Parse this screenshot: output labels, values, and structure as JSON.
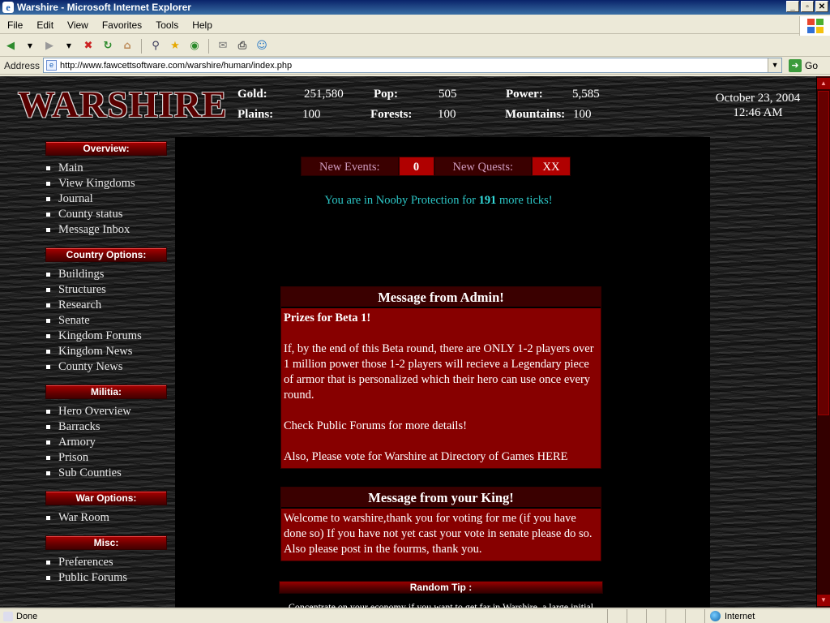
{
  "window": {
    "title": "Warshire - Microsoft Internet Explorer"
  },
  "menu": [
    "File",
    "Edit",
    "View",
    "Favorites",
    "Tools",
    "Help"
  ],
  "address": {
    "label": "Address",
    "url": "http://www.fawcettsoftware.com/warshire/human/index.php",
    "go": "Go"
  },
  "status": {
    "text": "Done",
    "zone": "Internet"
  },
  "page": {
    "logo": "WARSHIRE",
    "stats": {
      "gold_label": "Gold:",
      "gold": "251,580",
      "pop_label": "Pop:",
      "pop": "505",
      "power_label": "Power:",
      "power": "5,585",
      "plains_label": "Plains:",
      "plains": "100",
      "forests_label": "Forests:",
      "forests": "100",
      "mountains_label": "Mountains:",
      "mountains": "100"
    },
    "date": "October 23, 2004",
    "time": "12:46 AM",
    "sidebar": [
      {
        "header": "Overview:",
        "items": [
          "Main",
          "View Kingdoms",
          "Journal",
          "County status",
          "Message Inbox"
        ]
      },
      {
        "header": "Country Options:",
        "items": [
          "Buildings",
          "Structures",
          "Research",
          "Senate",
          "Kingdom Forums",
          "Kingdom News",
          "County News"
        ]
      },
      {
        "header": "Militia:",
        "items": [
          "Hero Overview",
          "Barracks",
          "Armory",
          "Prison",
          "Sub Counties"
        ]
      },
      {
        "header": "War Options:",
        "items": [
          "War Room"
        ]
      },
      {
        "header": "Misc:",
        "items": [
          "Preferences",
          "Public Forums"
        ]
      }
    ],
    "events": {
      "new_events_label": "New Events:",
      "new_events": "0",
      "new_quests_label": "New Quests:",
      "new_quests": "XX"
    },
    "nooby": {
      "prefix": "You are in Nooby Protection for ",
      "ticks": "191",
      "suffix": " more ticks!"
    },
    "admin_msg": {
      "title": "Message from Admin!",
      "heading": "Prizes for Beta 1!",
      "p1": "If, by the end of this Beta round, there are ONLY 1-2 players over 1 million power those 1-2 players will recieve a Legendary piece of armor that is personalized which their hero can use once every round.",
      "p2": "Check Public Forums for more details!",
      "p3": "Also, Please vote for Warshire at Directory of Games HERE"
    },
    "king_msg": {
      "title": "Message from your King!",
      "body": "Welcome to warshire,thank you for voting for me (if you have done so) If you have not yet cast your vote in senate please do so. Also please post in the fourms, thank you."
    },
    "tip": {
      "title": "Random Tip :",
      "text": "Concentrate on your economy if you want to get far in Warshire, a large initial army can easily be destroyed by a strong, well-funded army from someone who didn't go for the starting military"
    }
  }
}
